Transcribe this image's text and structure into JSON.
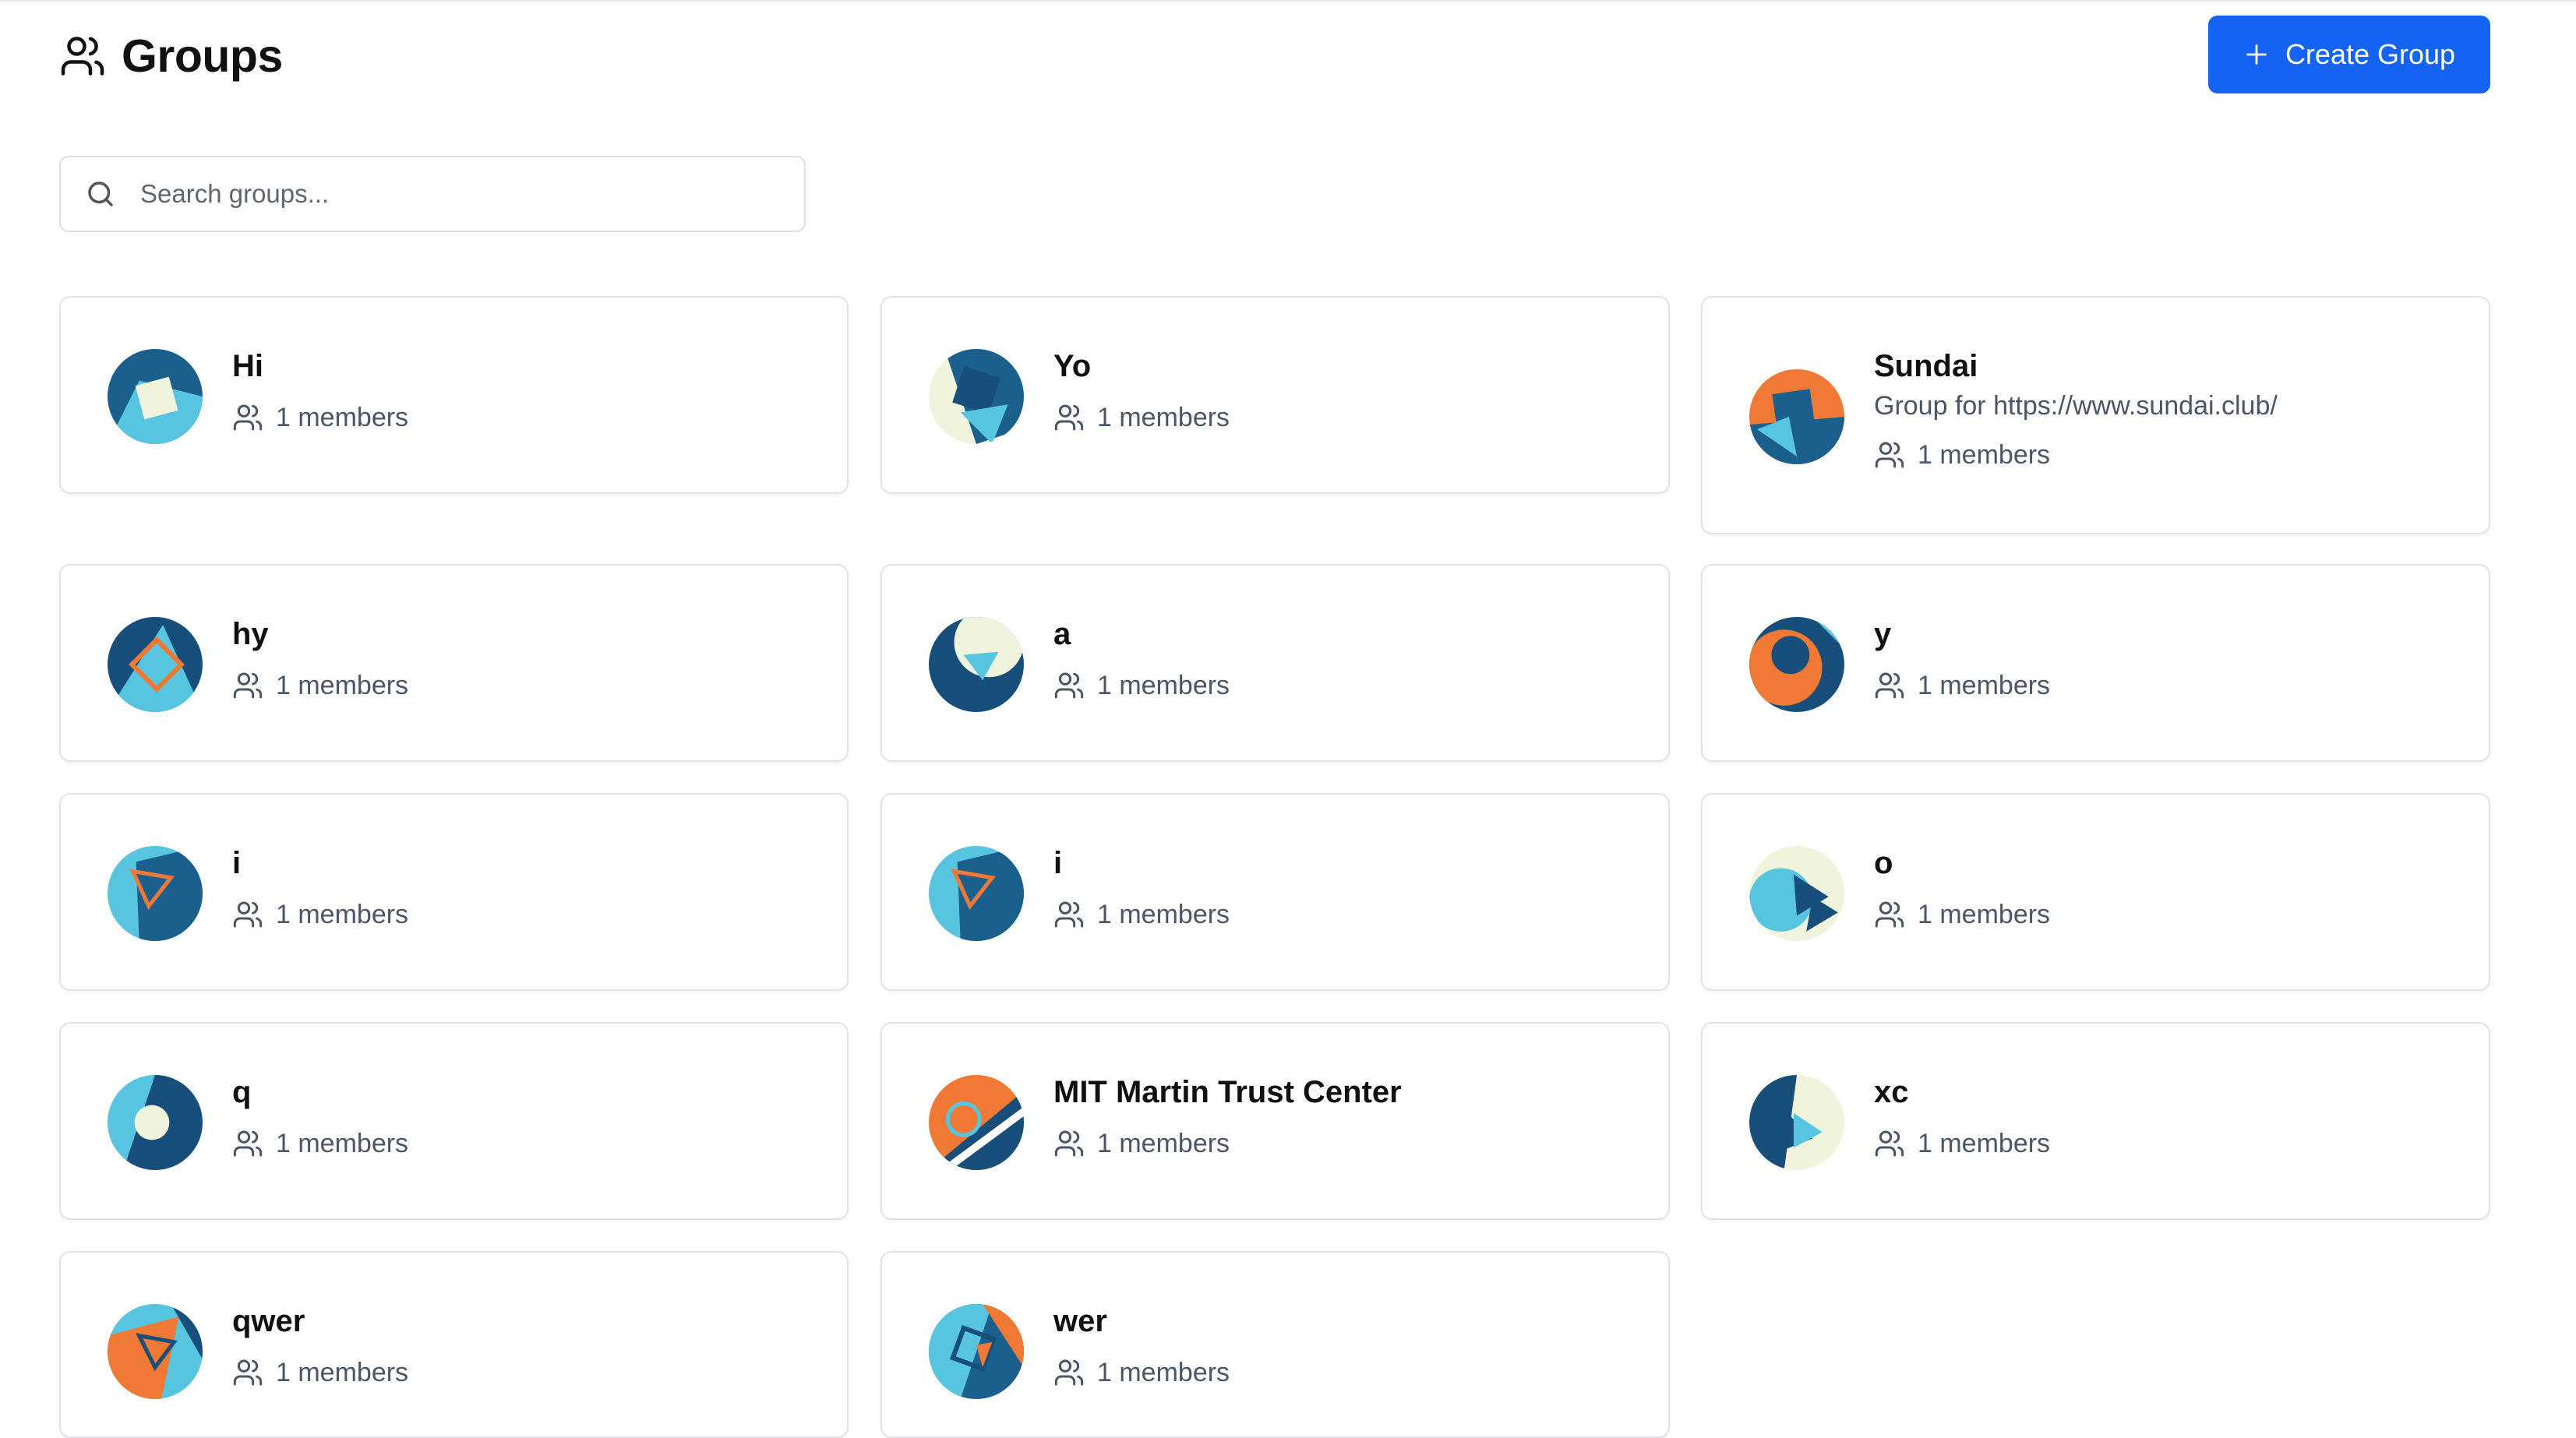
{
  "page": {
    "title": "Groups",
    "create_button_label": "Create Group",
    "search_placeholder": "Search groups..."
  },
  "groups": [
    {
      "name": "Hi",
      "description": "",
      "members": "1 members",
      "avatar_colors": [
        "#1b5f8c",
        "#58c5e0",
        "#f0f4dc"
      ]
    },
    {
      "name": "Yo",
      "description": "",
      "members": "1 members",
      "avatar_colors": [
        "#1b5f8c",
        "#58c5e0",
        "#f0f4dc"
      ]
    },
    {
      "name": "Sundai",
      "description": "Group for https://www.sundai.club/",
      "members": "1 members",
      "avatar_colors": [
        "#f07a35",
        "#58c5e0",
        "#1b5f8c"
      ]
    },
    {
      "name": "hy",
      "description": "",
      "members": "1 members",
      "avatar_colors": [
        "#174f7a",
        "#58c5e0",
        "#f07a35"
      ]
    },
    {
      "name": "a",
      "description": "",
      "members": "1 members",
      "avatar_colors": [
        "#174f7a",
        "#f0f4dc",
        "#58c5e0"
      ]
    },
    {
      "name": "y",
      "description": "",
      "members": "1 members",
      "avatar_colors": [
        "#58c5e0",
        "#f07a35",
        "#174f7a"
      ]
    },
    {
      "name": "i",
      "description": "",
      "members": "1 members",
      "avatar_colors": [
        "#1b5f8c",
        "#58c5e0",
        "#f07a35"
      ]
    },
    {
      "name": "i",
      "description": "",
      "members": "1 members",
      "avatar_colors": [
        "#1b5f8c",
        "#58c5e0",
        "#f07a35"
      ]
    },
    {
      "name": "o",
      "description": "",
      "members": "1 members",
      "avatar_colors": [
        "#f0f4dc",
        "#58c5e0",
        "#174f7a"
      ]
    },
    {
      "name": "q",
      "description": "",
      "members": "1 members",
      "avatar_colors": [
        "#58c5e0",
        "#174f7a",
        "#f0f4dc"
      ]
    },
    {
      "name": "MIT Martin Trust Center",
      "description": "",
      "members": "1 members",
      "avatar_colors": [
        "#f07a35",
        "#174f7a",
        "#58c5e0"
      ]
    },
    {
      "name": "xc",
      "description": "",
      "members": "1 members",
      "avatar_colors": [
        "#f0f4dc",
        "#174f7a",
        "#58c5e0"
      ]
    },
    {
      "name": "qwer",
      "description": "",
      "members": "1 members",
      "avatar_colors": [
        "#58c5e0",
        "#f07a35",
        "#174f7a"
      ]
    },
    {
      "name": "wer",
      "description": "",
      "members": "1 members",
      "avatar_colors": [
        "#1b5f8c",
        "#58c5e0",
        "#f07a35"
      ]
    }
  ],
  "colors": {
    "accent": "#1463f3",
    "border": "#e1e3e7",
    "muted_text": "#4b5563"
  },
  "icons": {
    "header": "users-icon",
    "create": "plus-icon",
    "search": "search-icon",
    "members": "users-icon"
  }
}
